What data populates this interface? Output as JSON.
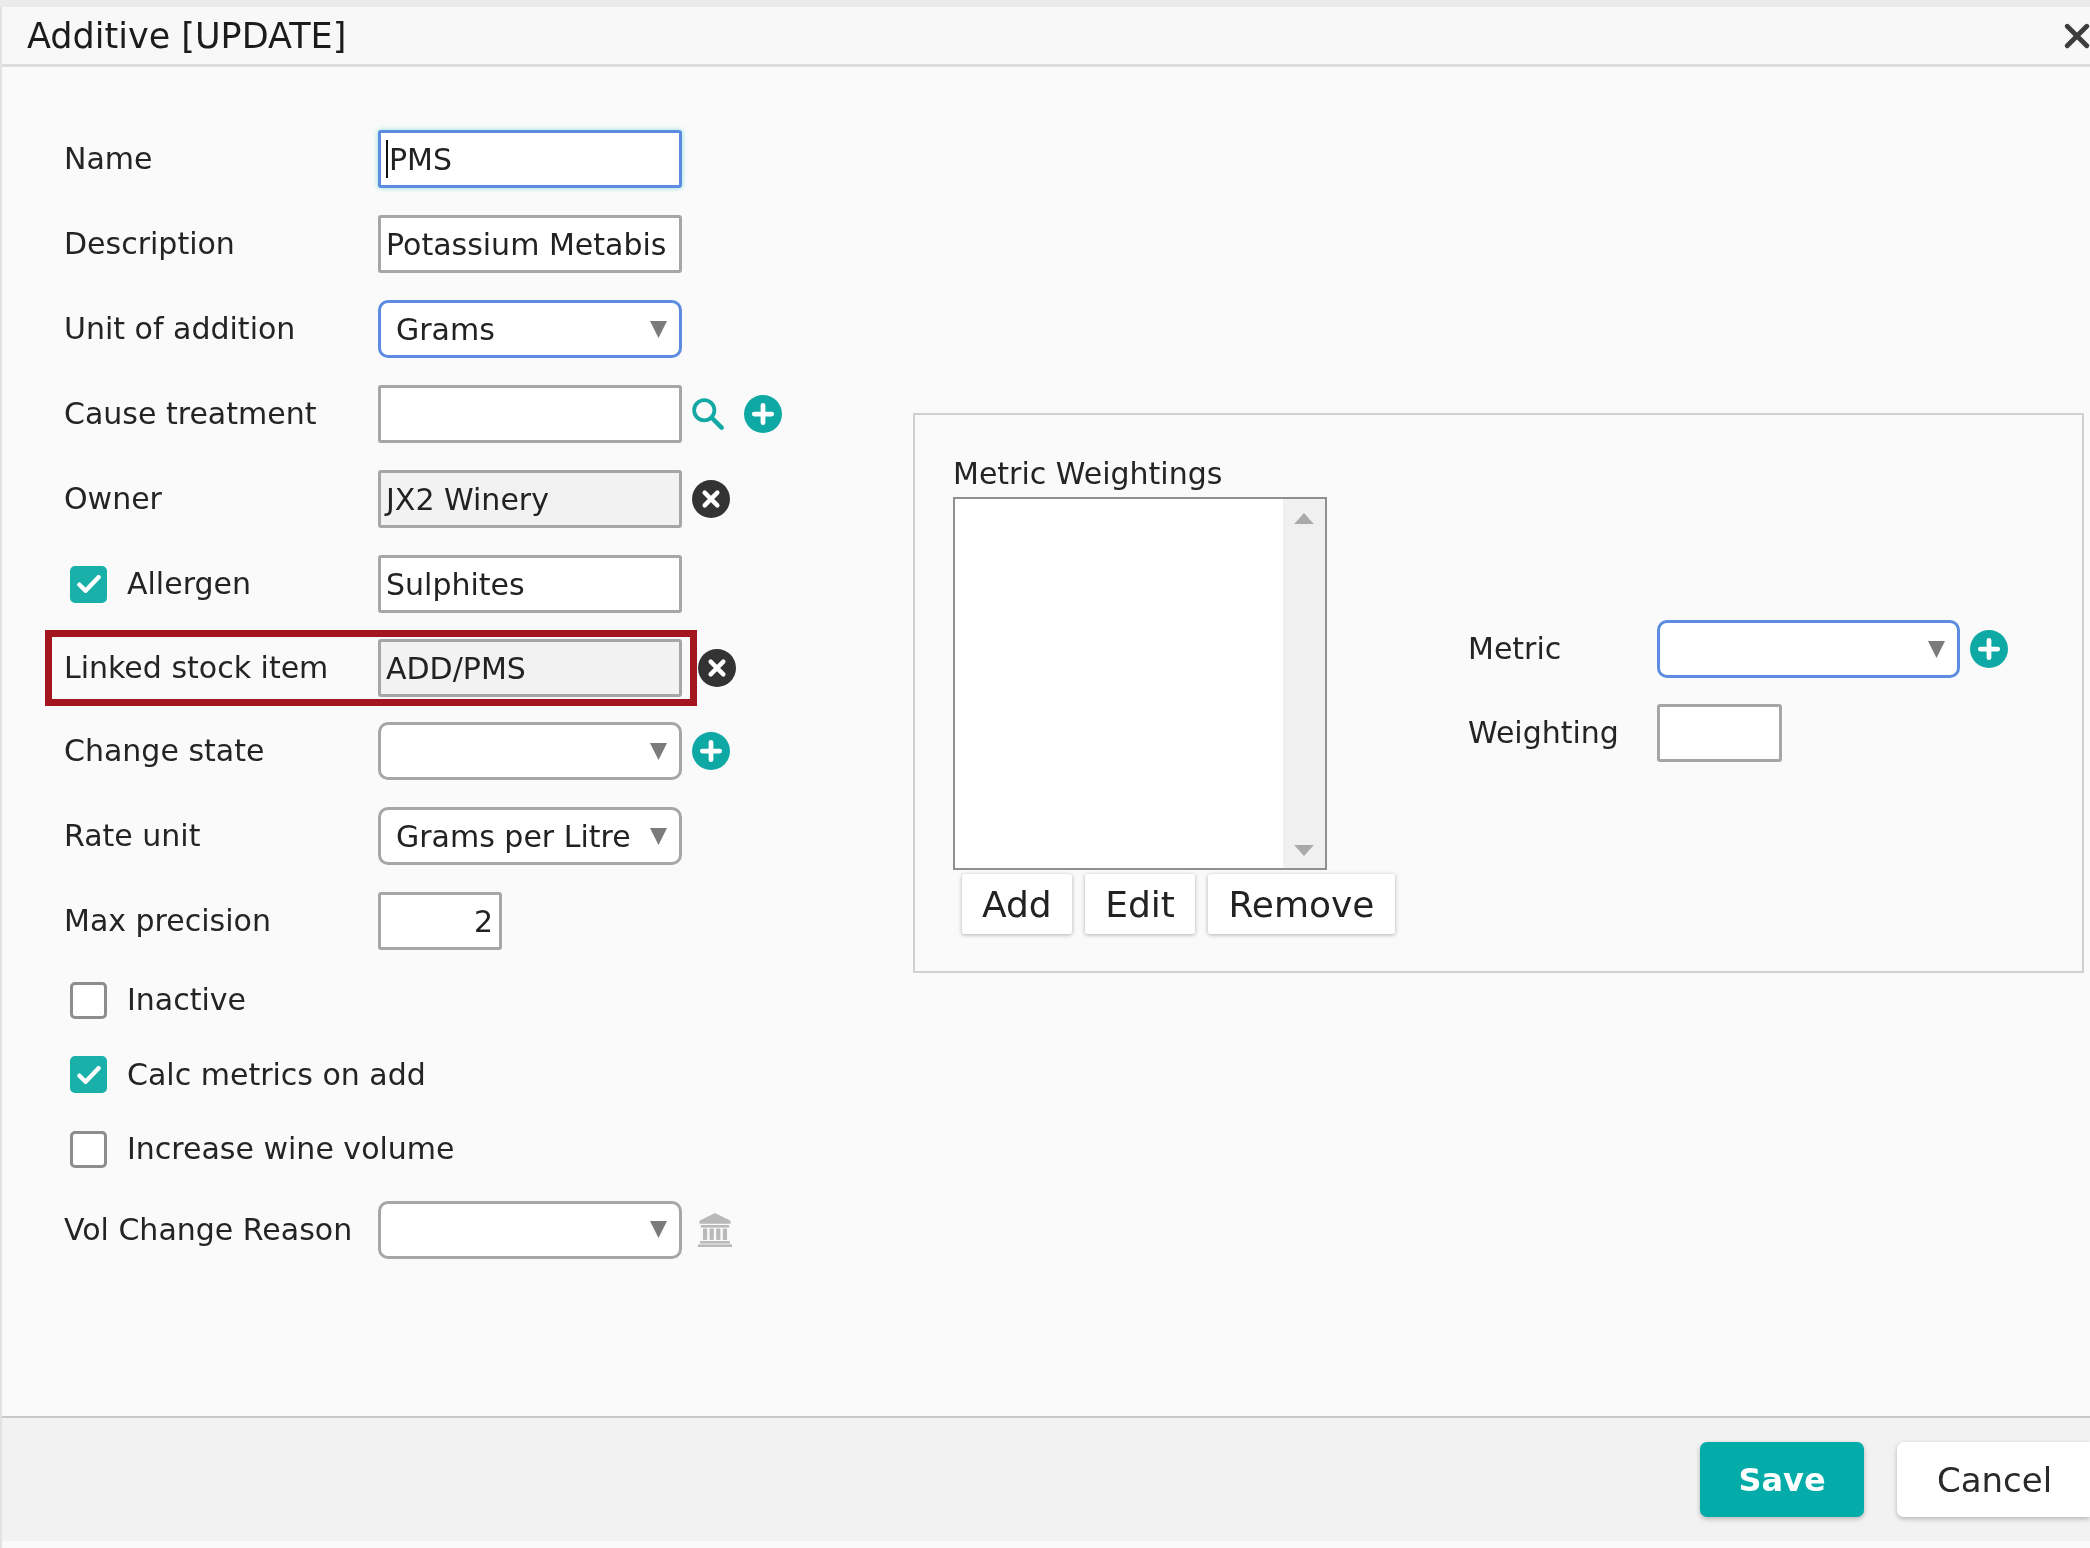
{
  "window": {
    "title": "Additive [UPDATE]"
  },
  "form": {
    "fields": [
      {
        "kind": "text",
        "label": "Name",
        "value": "PMS",
        "focused": true,
        "readonly": false,
        "highlighted": false
      },
      {
        "kind": "text",
        "label": "Description",
        "value": "Potassium Metabis",
        "focused": false,
        "readonly": false,
        "highlighted": false
      },
      {
        "kind": "select",
        "label": "Unit of addition",
        "value": "Grams",
        "focused": true,
        "highlighted": false
      },
      {
        "kind": "text",
        "label": "Cause treatment",
        "focused": false,
        "readonly": false,
        "highlighted": false,
        "actions": [
          {
            "kind": "search"
          },
          {
            "kind": "add"
          }
        ]
      },
      {
        "kind": "text",
        "label": "Owner",
        "value": "JX2 Winery",
        "focused": false,
        "readonly": true,
        "highlighted": false,
        "actions": [
          {
            "kind": "clear"
          }
        ]
      },
      {
        "kind": "checkbox-text",
        "label": "Allergen",
        "checked": true,
        "value": "Sulphites",
        "focused": false,
        "readonly": false,
        "highlighted": false
      },
      {
        "kind": "text",
        "label": "Linked stock item",
        "value": "ADD/PMS",
        "focused": false,
        "readonly": true,
        "highlighted": true,
        "actions": [
          {
            "kind": "clear"
          }
        ]
      },
      {
        "kind": "select",
        "label": "Change state",
        "focused": false,
        "highlighted": false,
        "actions": [
          {
            "kind": "add"
          }
        ]
      },
      {
        "kind": "select",
        "label": "Rate unit",
        "value": "Grams per Litre",
        "focused": false,
        "highlighted": false
      },
      {
        "kind": "number",
        "label": "Max precision",
        "value": "2",
        "focused": false,
        "highlighted": false
      },
      {
        "kind": "checkbox",
        "label": "Inactive",
        "checked": false,
        "highlighted": false
      },
      {
        "kind": "checkbox",
        "label": "Calc metrics on add",
        "checked": true,
        "highlighted": false
      },
      {
        "kind": "checkbox",
        "label": "Increase wine volume",
        "checked": false,
        "highlighted": false
      },
      {
        "kind": "select",
        "label": "Vol Change Reason",
        "focused": false,
        "highlighted": false,
        "actions": [
          {
            "kind": "bank"
          }
        ]
      }
    ]
  },
  "metric_weightings": {
    "title": "Metric Weightings",
    "buttons": [
      {
        "label": "Add"
      },
      {
        "label": "Edit"
      },
      {
        "label": "Remove"
      }
    ],
    "fields": [
      {
        "kind": "select",
        "label": "Metric",
        "focused": true,
        "actions": [
          {
            "kind": "add"
          }
        ]
      },
      {
        "kind": "text",
        "label": "Weighting",
        "focused": false,
        "readonly": false
      }
    ]
  },
  "footer": {
    "buttons": [
      {
        "label": "Save",
        "kind": "primary"
      },
      {
        "label": "Cancel",
        "kind": "secondary"
      }
    ]
  }
}
